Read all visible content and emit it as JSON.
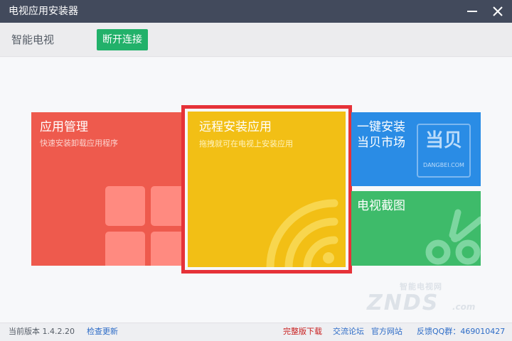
{
  "window": {
    "title": "电视应用安装器"
  },
  "toolbar": {
    "device_name": "智能电视",
    "disconnect_label": "断开连接"
  },
  "tiles": {
    "app_manage": {
      "title": "应用管理",
      "subtitle": "快速安装卸载应用程序"
    },
    "remote_install": {
      "title": "远程安装应用",
      "subtitle": "拖拽就可在电视上安装应用"
    },
    "dangbei": {
      "title_line1": "一键安装",
      "title_line2": "当贝市场",
      "logo_text": "当贝",
      "logo_sub": "DANGBEI.COM"
    },
    "tv_screenshot": {
      "title": "电视截图"
    }
  },
  "watermark": {
    "top": "智能电视网",
    "main": "ZNDS",
    "suffix": ".com"
  },
  "statusbar": {
    "version": "当前版本 1.4.2.20",
    "check_update": "检查更新",
    "full_download": "完整版下载",
    "forum": "交流论坛",
    "official_site": "官方网站",
    "qq_group": "反馈QQ群：469010427"
  },
  "colors": {
    "titlebar": "#424a5c",
    "connect_green": "#22b16a",
    "tile_red": "#ee5a4d",
    "tile_yellow": "#f2bf15",
    "tile_blue": "#2a8ce5",
    "tile_green": "#3ebb6a",
    "highlight_border": "#e63238"
  },
  "icons": {
    "minimize": "minimize-icon",
    "close": "close-icon",
    "app_grid": "app-grid-icon",
    "wifi": "wifi-icon",
    "dangbei_logo": "dangbei-logo",
    "scissors": "scissors-icon"
  }
}
